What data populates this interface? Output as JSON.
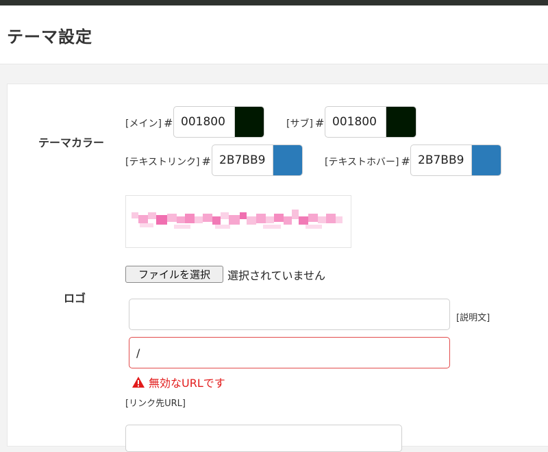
{
  "page": {
    "title": "テーマ設定"
  },
  "theme_color": {
    "label": "テーマカラー",
    "hash": "#",
    "main": {
      "label": "[メイン]",
      "value": "001800",
      "color": "#001800"
    },
    "sub": {
      "label": "[サブ]",
      "value": "001800",
      "color": "#001800"
    },
    "text_link": {
      "label": "[テキストリンク]",
      "value": "2B7BB9",
      "color": "#2B7BB9"
    },
    "text_hover": {
      "label": "[テキストホバー]",
      "value": "2B7BB9",
      "color": "#2B7BB9"
    }
  },
  "logo": {
    "label": "ロゴ",
    "file_button": "ファイルを選択",
    "file_status": "選択されていません",
    "description": {
      "value": "",
      "label": "[説明文]"
    },
    "link_url": {
      "value": "/",
      "label": "[リンク先URL]",
      "error": "無効なURLです"
    }
  }
}
